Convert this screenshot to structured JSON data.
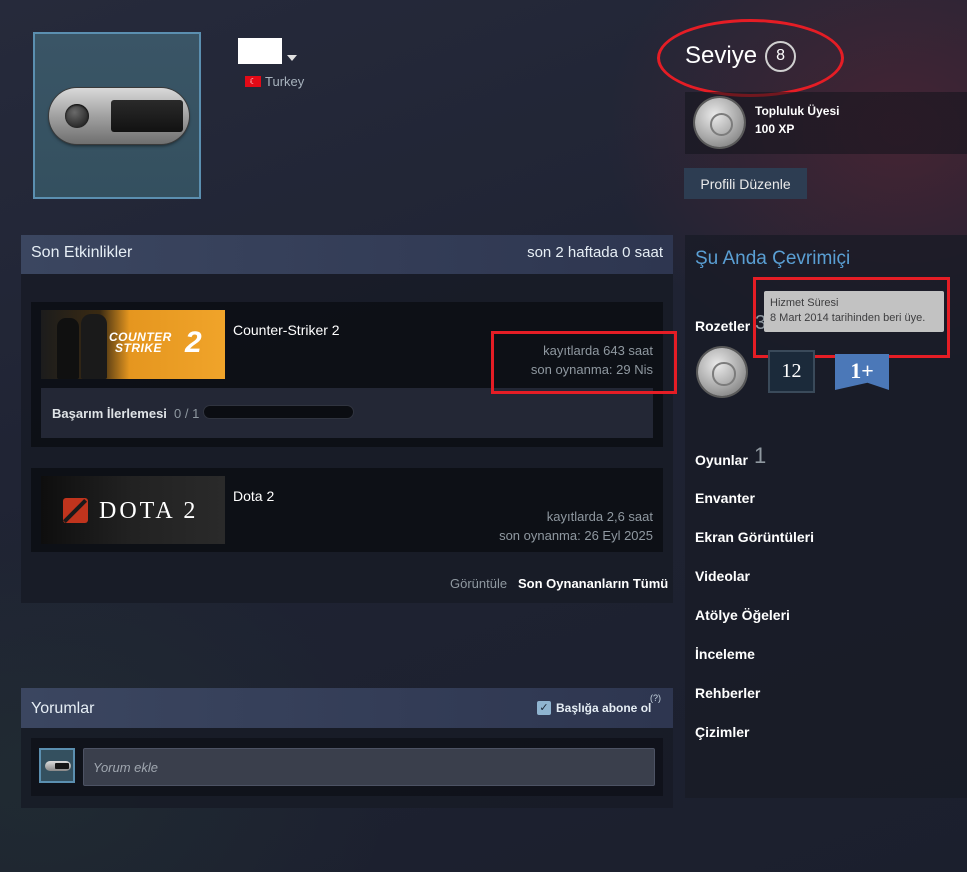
{
  "profile": {
    "country": "Turkey",
    "level_label": "Seviye",
    "level": "8",
    "badge": {
      "name": "Topluluk Üyesi",
      "xp": "100 XP"
    },
    "edit_button": "Profili Düzenle"
  },
  "recent": {
    "title": "Son Etkinlikler",
    "hours_summary": "son 2 haftada 0 saat",
    "games": [
      {
        "name": "Counter-Striker 2",
        "banner_text_line1": "COUNTER",
        "banner_text_line2": "STRIKE",
        "banner_number": "2",
        "hours_on_record": "kayıtlarda 643 saat",
        "last_played": "son oynanma: 29 Nis",
        "achievement_label": "Başarım İlerlemesi",
        "achievement_count": "0 / 1",
        "achievement_progress": 0
      },
      {
        "name": "Dota 2",
        "banner_text": "DOTA 2",
        "hours_on_record": "kayıtlarda 2,6 saat",
        "last_played": "son oynanma: 26 Eyl 2025"
      }
    ],
    "view_label": "Görüntüle",
    "view_all_link": "Son Oynananların Tümü"
  },
  "comments": {
    "title": "Yorumlar",
    "subscribe_label": "Başlığa abone ol",
    "subscribe_checked": true,
    "help_mark": "(?)",
    "input_placeholder": "Yorum ekle"
  },
  "sidebar": {
    "online_status": "Şu Anda Çevrimiçi",
    "badges_label": "Rozetler",
    "badges_count": "3",
    "tooltip_title": "Hizmet Süresi",
    "tooltip_text": "8 Mart 2014 tarihinden beri üye.",
    "years_badge": "12",
    "plus_badge": "1+",
    "games_label": "Oyunlar",
    "games_count": "1",
    "links": [
      "Envanter",
      "Ekran Görüntüleri",
      "Videolar",
      "Atölye Öğeleri",
      "İnceleme",
      "Rehberler",
      "Çizimler"
    ]
  },
  "colors": {
    "highlight_red": "#e51d25",
    "online_blue": "#5a9fd4",
    "edit_button_bg": "#2d3d52"
  }
}
